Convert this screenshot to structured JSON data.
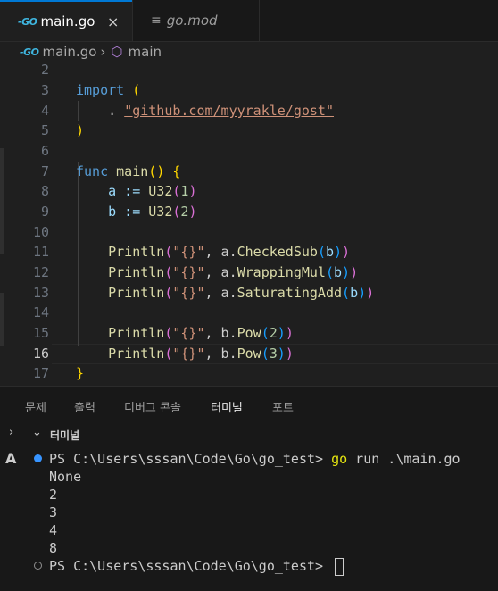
{
  "tabs": [
    {
      "icon": "go-file-icon",
      "icon_text": "-GO",
      "label": "main.go",
      "close": "×"
    },
    {
      "icon": "text-lines-icon",
      "icon_text": "≡",
      "label": "go.mod"
    }
  ],
  "breadcrumb": {
    "file_icon_text": "-GO",
    "file": "main.go",
    "sep": "›",
    "symbol_icon": "cube-icon",
    "symbol_icon_text": "⬡",
    "symbol": "main"
  },
  "editor": {
    "current_line": "16",
    "lines": [
      {
        "n": "2"
      },
      {
        "n": "3"
      },
      {
        "n": "4"
      },
      {
        "n": "5"
      },
      {
        "n": "6"
      },
      {
        "n": "7"
      },
      {
        "n": "8"
      },
      {
        "n": "9"
      },
      {
        "n": "10"
      },
      {
        "n": "11"
      },
      {
        "n": "12"
      },
      {
        "n": "13"
      },
      {
        "n": "14"
      },
      {
        "n": "15"
      },
      {
        "n": "16"
      },
      {
        "n": "17"
      }
    ],
    "tokens": {
      "import": "import",
      "lparen": " (",
      "dot": "    . ",
      "path": "\"github.com/myyrakle/gost\"",
      "rparen": ")",
      "func": "func ",
      "main": "main",
      "sig_open": "(",
      "sig_close": ")",
      "brace_open": " {",
      "a_decl": "    a := ",
      "b_decl": "    b := ",
      "u32": "U32",
      "po": "(",
      "pc": ")",
      "one": "1",
      "two": "2",
      "println": "    Println",
      "fmt": "\"{}\"",
      "comma_a": ", a.",
      "comma_b": ", b.",
      "checked_sub": "CheckedSub",
      "wrapping_mul": "WrappingMul",
      "saturating_add": "SaturatingAdd",
      "pow": "Pow",
      "arg_b": "b",
      "arg_2": "2",
      "arg_3": "3",
      "brace_close": "}"
    }
  },
  "panel": {
    "tabs": [
      "문제",
      "출력",
      "디버그 콘솔",
      "터미널",
      "포트"
    ],
    "active_tab": "터미널",
    "terminal_section_label": "터미널",
    "chevron_right": "›",
    "chevron_down": "⌄"
  },
  "terminal": {
    "shell_icon_text": "A",
    "prompt": "PS C:\\Users\\sssan\\Code\\Go\\go_test> ",
    "command": "go",
    "command_args": " run .\\main.go",
    "output": [
      "None",
      "2",
      "3",
      "4",
      "8"
    ]
  },
  "colors": {
    "accent": "#0078d4",
    "keyword": "#569cd6",
    "function": "#dcdcaa",
    "string": "#ce9178"
  }
}
